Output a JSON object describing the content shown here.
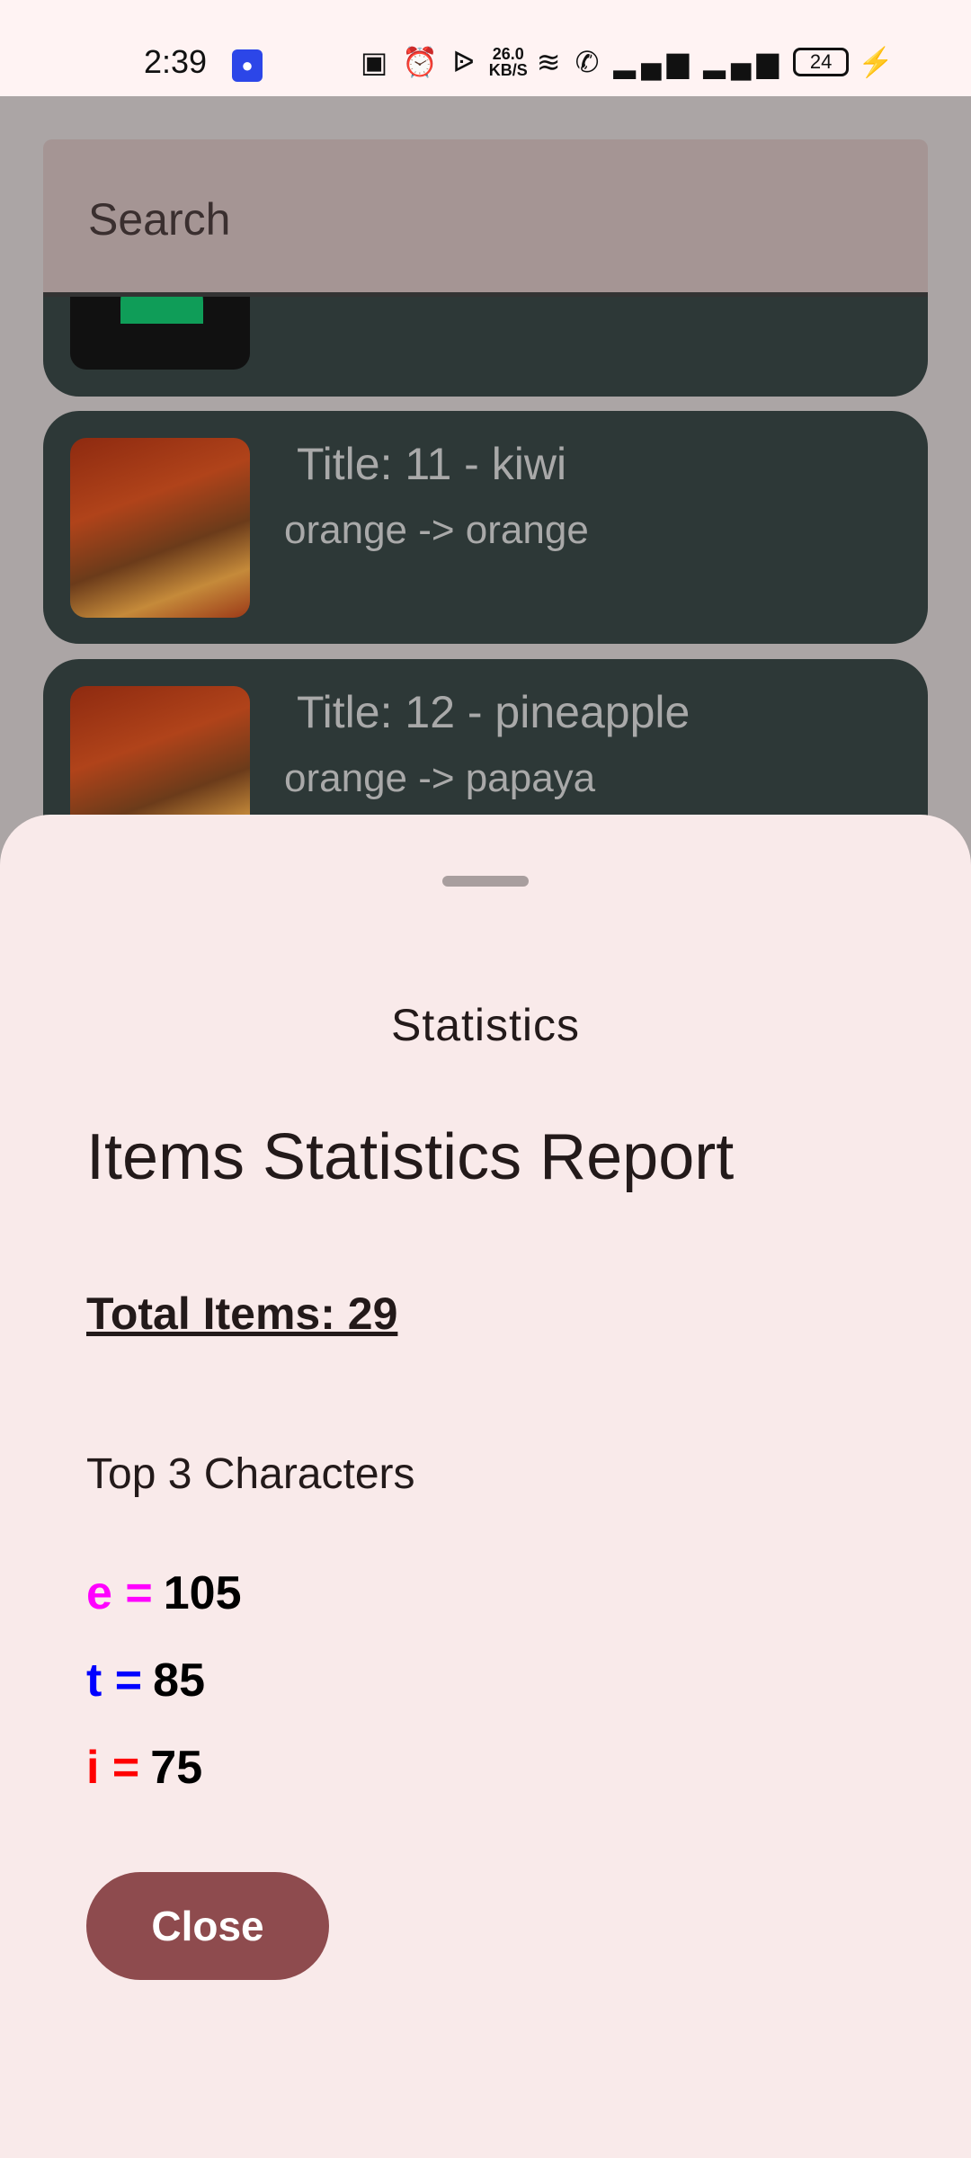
{
  "status_bar": {
    "time": "2:39",
    "net_speed": "26.0",
    "net_unit": "KB/S",
    "battery": "24"
  },
  "search": {
    "placeholder": "Search"
  },
  "list": {
    "items": [
      {
        "title": "",
        "subtitle": "",
        "image": "android-icon"
      },
      {
        "title": "Title: 11 - kiwi",
        "subtitle": "orange -> orange",
        "image": "autumn-forest"
      },
      {
        "title": "Title: 12 - pineapple",
        "subtitle": "orange -> papaya",
        "image": "autumn-forest"
      }
    ]
  },
  "sheet": {
    "title": "Statistics",
    "report_title": "Items Statistics Report",
    "total_items": "Total Items: 29",
    "top_heading": "Top 3 Characters",
    "characters": [
      {
        "char": "e",
        "eq": "=",
        "count": "105",
        "color": "#ff00ff"
      },
      {
        "char": "t",
        "eq": "=",
        "count": "85",
        "color": "#0000ff"
      },
      {
        "char": "i",
        "eq": "=",
        "count": "75",
        "color": "#ff0000"
      }
    ],
    "close_label": "Close"
  },
  "colors": {
    "accent": "#8e4b4e",
    "sheet_bg": "#f9eaea",
    "card_bg": "#2d3837"
  }
}
